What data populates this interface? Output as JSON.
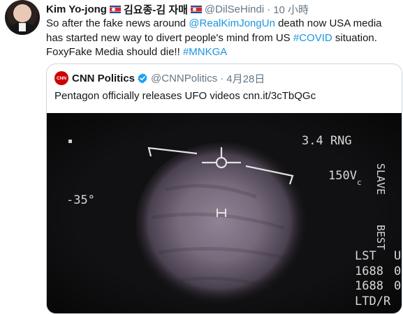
{
  "tweet": {
    "author_name": "Kim Yo-jong",
    "korean_name": "김요종-김 자매",
    "handle": "@DilSeHindi",
    "separator": "·",
    "time": "10 小時",
    "text_1": "So after the fake news around ",
    "mention": "@RealKimJongUn",
    "text_2": " death now USA media has started new way to divert people's mind from US ",
    "hashtag_covid": "#COVID",
    "text_3": " situation. FoxyFake Media should die!! ",
    "hashtag_mnkga": "#MNKGA"
  },
  "quoted": {
    "logo_text": "CNN",
    "name": "CNN Politics",
    "handle": "@CNNPolitics",
    "separator": "·",
    "date": "4月28日",
    "text": "Pentagon officially releases UFO videos cnn.it/3cTbQGc"
  },
  "hud": {
    "rng": "3.4 RNG",
    "angle": "-35°",
    "speed": "150V",
    "speed_suffix": "c",
    "slave": "SLAVE",
    "best": "BEST",
    "lst": "LST",
    "num1": "1688",
    "num2": "1688",
    "ltd": "LTD/R",
    "edge1": "U",
    "edge2": "0",
    "edge3": "0"
  },
  "colors": {
    "link": "#1b95e0",
    "verified": "#1da1f2",
    "cnn_red": "#cc0000",
    "flag_red": "#d22b2b",
    "flag_blue": "#1c4fa0"
  },
  "icons": [
    "north-korea-flag-icon",
    "verified-badge-icon",
    "cnn-logo-icon"
  ]
}
